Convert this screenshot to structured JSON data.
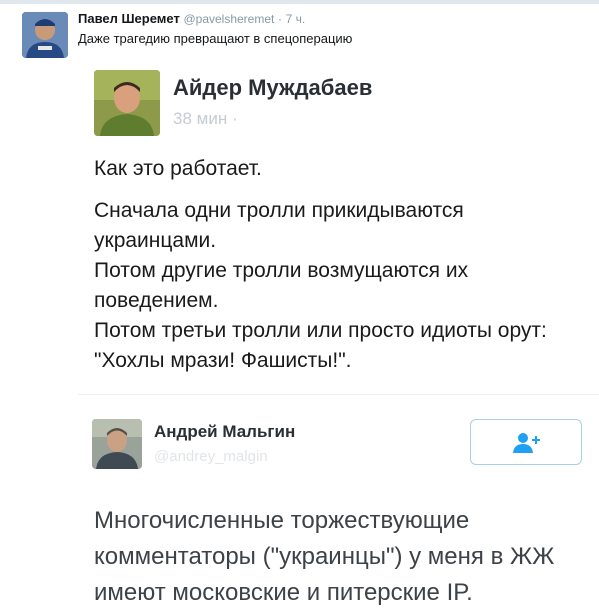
{
  "outer_tweet": {
    "author_name": "Павел Шеремет",
    "author_handle": "@pavelsheremet",
    "separator": "·",
    "time": "7 ч.",
    "text": "Даже трагедию превращают в спецоперацию"
  },
  "embedded_tweet": {
    "author_name": "Айдер Муждабаев",
    "time": "38 мин",
    "time_dot": "·",
    "lines": [
      "Как это работает.",
      "Сначала одни тролли прикидываются украинцами.",
      "Потом другие тролли возмущаются их поведением.",
      "Потом третьи тролли или просто идиоты орут: \"Хохлы мрази! Фашисты!\"."
    ],
    "quoted": {
      "author_name": "Андрей Мальгин",
      "author_handle": "@andrey_malgin",
      "follow_icon": "add-user-icon",
      "text": "Многочисленные торжествующие комментаторы (\"украинцы\") у меня в ЖЖ имеют московские и питерские IP."
    }
  },
  "colors": {
    "link_blue": "#1da1f2",
    "muted_gray": "#8899a6",
    "follow_border": "#a9cfe9"
  }
}
